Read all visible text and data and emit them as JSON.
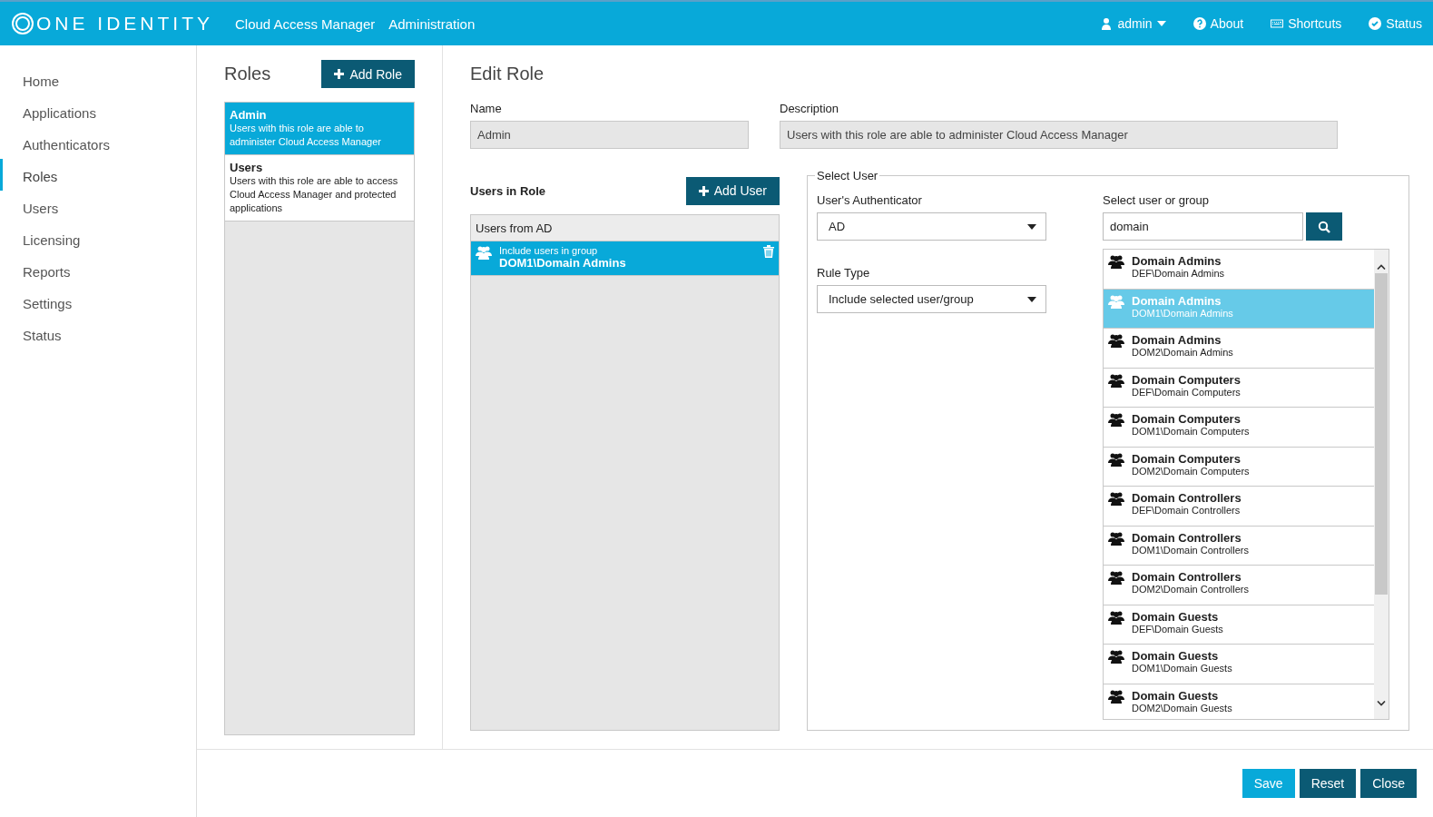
{
  "header": {
    "logo": "ONE IDENTITY",
    "app_title": "Cloud Access Manager",
    "section": "Administration",
    "user": "admin",
    "links": [
      {
        "kind": "about",
        "label": "About"
      },
      {
        "kind": "shortcuts",
        "label": "Shortcuts"
      },
      {
        "kind": "status",
        "label": "Status"
      }
    ]
  },
  "sidebar": {
    "items": [
      {
        "label": "Home",
        "selected": false
      },
      {
        "label": "Applications",
        "selected": false
      },
      {
        "label": "Authenticators",
        "selected": false
      },
      {
        "label": "Roles",
        "selected": true
      },
      {
        "label": "Users",
        "selected": false
      },
      {
        "label": "Licensing",
        "selected": false
      },
      {
        "label": "Reports",
        "selected": false
      },
      {
        "label": "Settings",
        "selected": false
      },
      {
        "label": "Status",
        "selected": false
      }
    ]
  },
  "roles": {
    "title": "Roles",
    "add_button": "Add Role",
    "items": [
      {
        "name": "Admin",
        "description": "Users with this role are able to administer Cloud Access Manager",
        "selected": true
      },
      {
        "name": "Users",
        "description": "Users with this role are able to access Cloud Access Manager and protected applications",
        "selected": false
      }
    ]
  },
  "edit_role": {
    "title": "Edit Role",
    "name_label": "Name",
    "name_value": "Admin",
    "description_label": "Description",
    "description_value": "Users with this role are able to administer Cloud Access Manager",
    "users_in_role": {
      "label": "Users in Role",
      "add_button": "Add User",
      "group_header": "Users from AD",
      "members": [
        {
          "rule": "Include users in group",
          "name": "DOM1\\Domain Admins",
          "selected": true
        }
      ]
    },
    "select_user": {
      "legend": "Select User",
      "authenticator_label": "User's Authenticator",
      "authenticator_value": "AD",
      "rule_type_label": "Rule Type",
      "rule_type_value": "Include selected user/group",
      "search_label": "Select user or group",
      "search_value": "domain",
      "results": [
        {
          "name": "Domain Admins",
          "path": "DEF\\Domain Admins",
          "selected": false
        },
        {
          "name": "Domain Admins",
          "path": "DOM1\\Domain Admins",
          "selected": true
        },
        {
          "name": "Domain Admins",
          "path": "DOM2\\Domain Admins",
          "selected": false
        },
        {
          "name": "Domain Computers",
          "path": "DEF\\Domain Computers",
          "selected": false
        },
        {
          "name": "Domain Computers",
          "path": "DOM1\\Domain Computers",
          "selected": false
        },
        {
          "name": "Domain Computers",
          "path": "DOM2\\Domain Computers",
          "selected": false
        },
        {
          "name": "Domain Controllers",
          "path": "DEF\\Domain Controllers",
          "selected": false
        },
        {
          "name": "Domain Controllers",
          "path": "DOM1\\Domain Controllers",
          "selected": false
        },
        {
          "name": "Domain Controllers",
          "path": "DOM2\\Domain Controllers",
          "selected": false
        },
        {
          "name": "Domain Guests",
          "path": "DEF\\Domain Guests",
          "selected": false
        },
        {
          "name": "Domain Guests",
          "path": "DOM1\\Domain Guests",
          "selected": false
        },
        {
          "name": "Domain Guests",
          "path": "DOM2\\Domain Guests",
          "selected": false
        }
      ]
    }
  },
  "footer": {
    "buttons": [
      {
        "kind": "primary",
        "label": "Save"
      },
      {
        "kind": "dark",
        "label": "Reset"
      },
      {
        "kind": "dark",
        "label": "Close"
      }
    ]
  }
}
